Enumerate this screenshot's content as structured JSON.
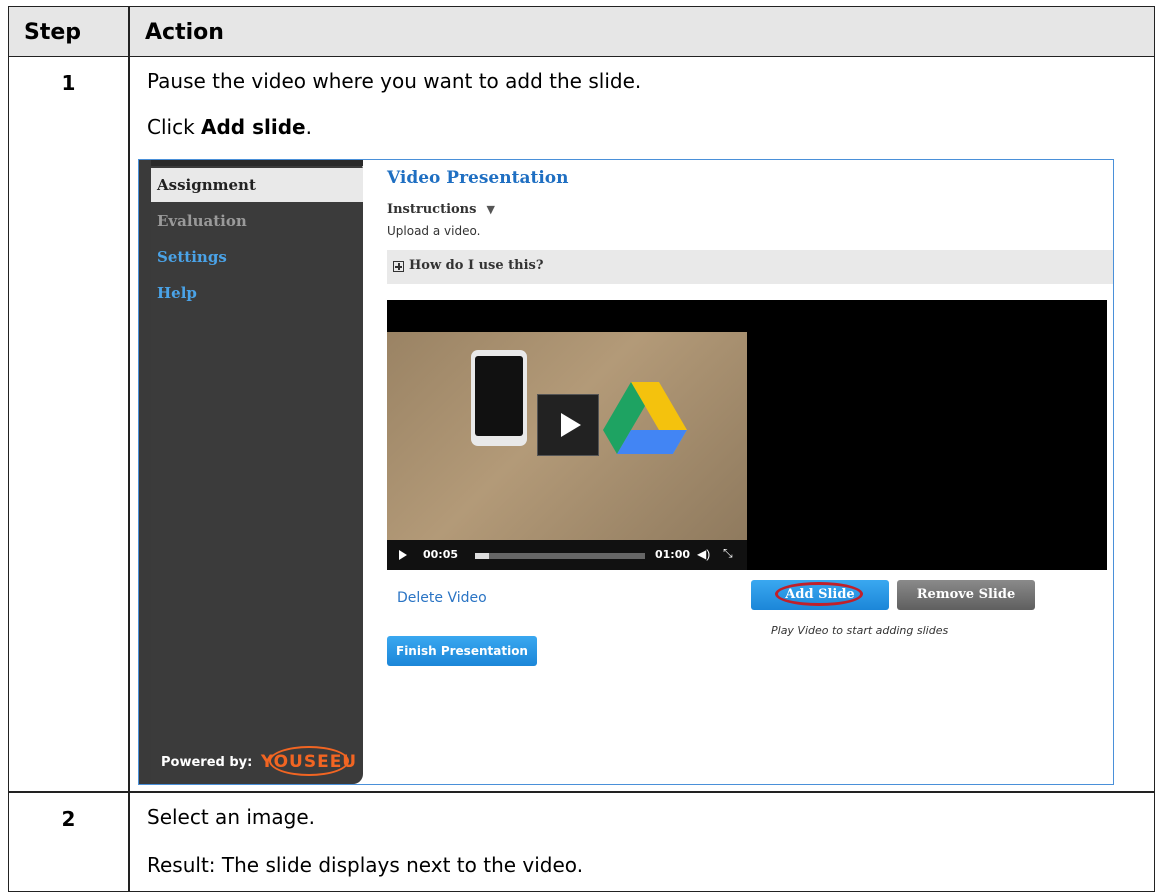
{
  "table": {
    "header_step": "Step",
    "header_action": "Action",
    "rows": [
      {
        "step": "1",
        "line1": "Pause the video where you want to add the slide.",
        "line2_pre": "Click ",
        "line2_bold": "Add slide",
        "line2_post": "."
      },
      {
        "step": "2",
        "line1": "Select an image.",
        "line2": "Result: The slide displays next to the video."
      }
    ]
  },
  "app": {
    "sidebar": {
      "items": [
        "Assignment",
        "Evaluation",
        "Settings",
        "Help"
      ],
      "powered_by": "Powered by:",
      "logo_text": "YOUSEEU"
    },
    "title": "Video Presentation",
    "instructions_label": "Instructions",
    "instructions_text": "Upload a video.",
    "how_label": "How do I use this?",
    "player": {
      "current_time": "00:05",
      "duration": "01:00",
      "progress": 0.08
    },
    "delete_video": "Delete Video",
    "add_slide": "Add Slide",
    "remove_slide": "Remove Slide",
    "hint": "Play Video to start adding slides",
    "finish": "Finish Presentation"
  },
  "colors": {
    "accent_blue": "#1c86d8",
    "highlight_red": "#c0202a",
    "logo_orange": "#f26522"
  }
}
